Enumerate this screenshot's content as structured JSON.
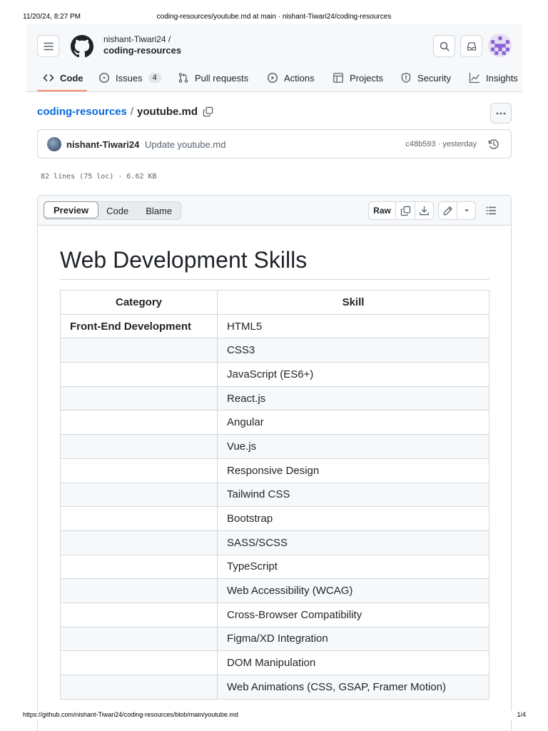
{
  "print_header": {
    "datetime": "11/20/24, 8:27 PM",
    "page_title": "coding-resources/youtube.md at main · nishant-Tiwari24/coding-resources"
  },
  "header": {
    "owner": "nishant-Tiwari24 /",
    "repo": "coding-resources"
  },
  "nav": {
    "code": "Code",
    "issues": "Issues",
    "issues_count": "4",
    "pull_requests": "Pull requests",
    "actions": "Actions",
    "projects": "Projects",
    "security": "Security",
    "insights": "Insights"
  },
  "breadcrumb": {
    "repo": "coding-resources",
    "separator": "/",
    "file": "youtube.md"
  },
  "commit": {
    "author": "nishant-Tiwari24",
    "message": "Update youtube.md",
    "meta": "c48b593 · yesterday"
  },
  "file_stats": "82 lines (75 loc) · 6.62 KB",
  "toolbar": {
    "tabs": [
      "Preview",
      "Code",
      "Blame"
    ],
    "raw_label": "Raw"
  },
  "content": {
    "heading": "Web Development Skills",
    "table_headers": [
      "Category",
      "Skill"
    ],
    "rows": [
      {
        "category": "Front-End Development",
        "skill": "HTML5"
      },
      {
        "category": "",
        "skill": "CSS3"
      },
      {
        "category": "",
        "skill": "JavaScript (ES6+)"
      },
      {
        "category": "",
        "skill": "React.js"
      },
      {
        "category": "",
        "skill": "Angular"
      },
      {
        "category": "",
        "skill": "Vue.js"
      },
      {
        "category": "",
        "skill": "Responsive Design"
      },
      {
        "category": "",
        "skill": "Tailwind CSS"
      },
      {
        "category": "",
        "skill": "Bootstrap"
      },
      {
        "category": "",
        "skill": "SASS/SCSS"
      },
      {
        "category": "",
        "skill": "TypeScript"
      },
      {
        "category": "",
        "skill": "Web Accessibility (WCAG)"
      },
      {
        "category": "",
        "skill": "Cross-Browser Compatibility"
      },
      {
        "category": "",
        "skill": "Figma/XD Integration"
      },
      {
        "category": "",
        "skill": "DOM Manipulation"
      },
      {
        "category": "",
        "skill": "Web Animations (CSS, GSAP, Framer Motion)"
      }
    ]
  },
  "print_footer": {
    "url": "https://github.com/nishant-Tiwari24/coding-resources/blob/main/youtube.md",
    "page": "1/4"
  },
  "colors": {
    "link": "#0969da",
    "nav_underline": "#fd8c73",
    "border": "#d1d9e0",
    "muted_text": "#59636e"
  }
}
